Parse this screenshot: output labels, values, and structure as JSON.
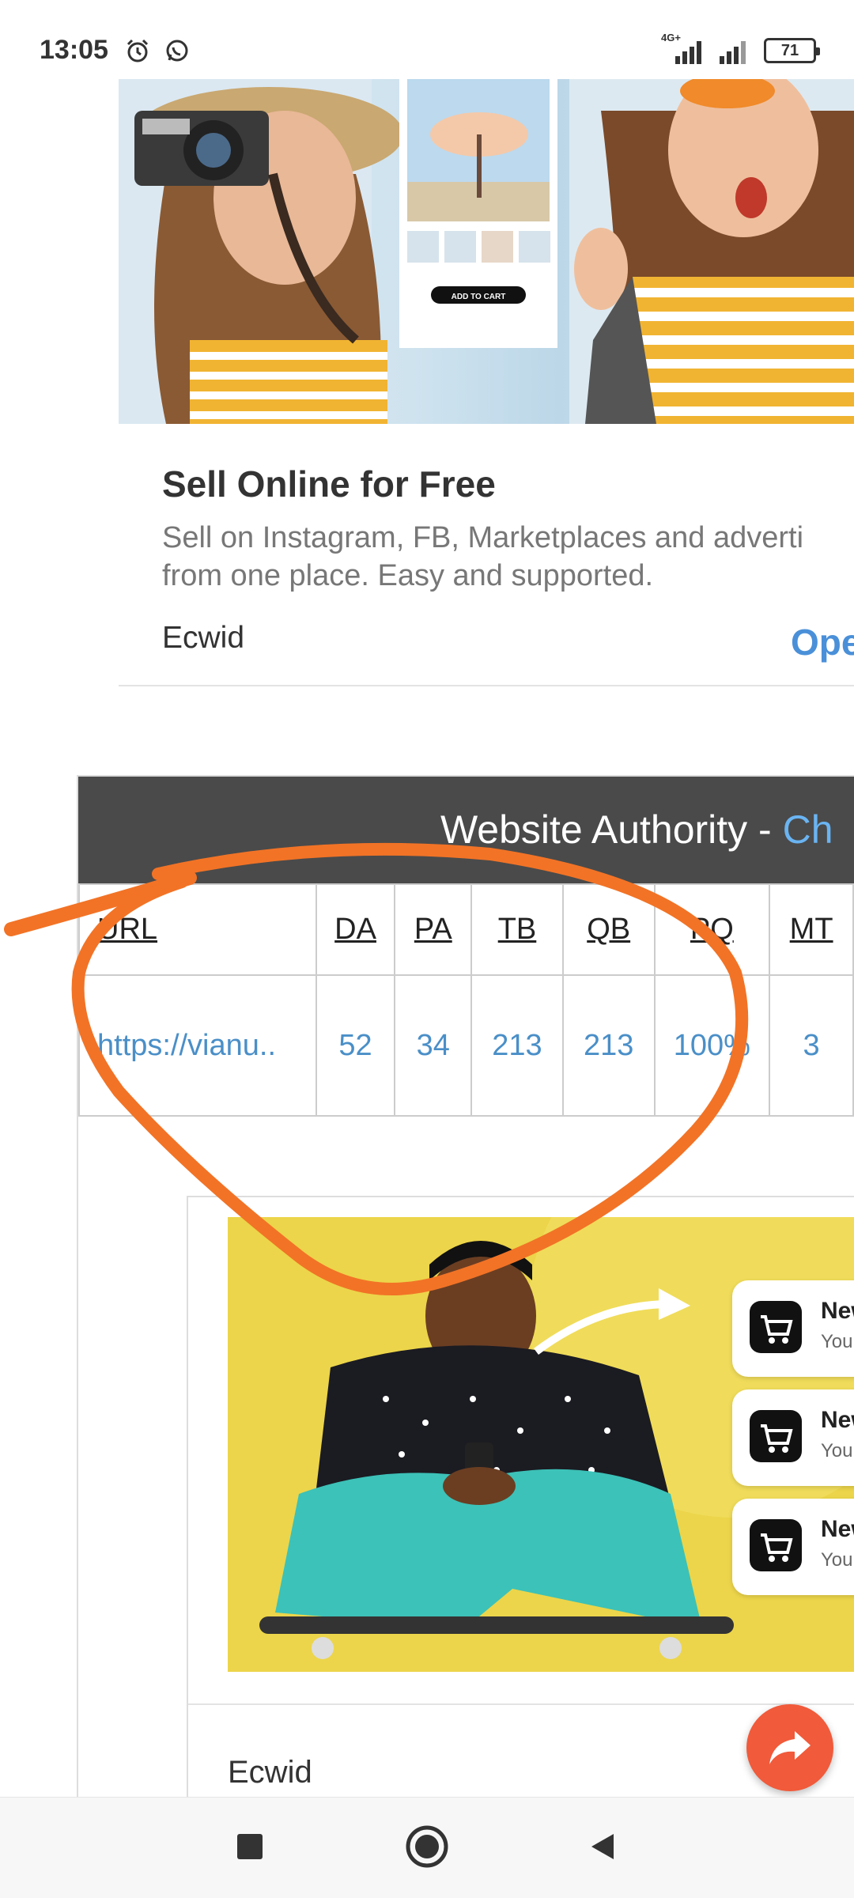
{
  "status_bar": {
    "time": "13:05",
    "network": "4G+",
    "battery": "71",
    "icons": [
      "alarm-icon",
      "whatsapp-icon",
      "signal-icon",
      "signal-icon",
      "battery-icon"
    ]
  },
  "ad_card": {
    "image_button": "ADD TO CART",
    "title": "Sell Online for Free",
    "description_line1": "Sell on Instagram, FB, Marketplaces and adverti",
    "description_line2": "from one place. Easy and supported.",
    "brand": "Ecwid",
    "cta": "Ope"
  },
  "authority": {
    "title": "Website Authority - ",
    "title_accent": "Ch",
    "columns": [
      "URL",
      "DA",
      "PA",
      "TB",
      "QB",
      "PQ",
      "MT"
    ],
    "row": {
      "url": "https://vianu..",
      "da": "52",
      "pa": "34",
      "tb": "213",
      "qb": "213",
      "pq": "100%",
      "mt": "3"
    }
  },
  "inner_ad": {
    "brand": "Ecwid",
    "notifications": [
      {
        "title": "New",
        "subtitle": "You"
      },
      {
        "title": "New",
        "subtitle": "You"
      },
      {
        "title": "New",
        "subtitle": "You"
      }
    ]
  },
  "colors": {
    "link": "#4a8fc8",
    "header_bg": "#4a4a4a",
    "accent": "#6ab4f2",
    "annotation": "#f27326",
    "fab": "#f15a3a"
  },
  "nav": {
    "icons": [
      "recents-square-icon",
      "home-circle-icon",
      "back-triangle-icon"
    ]
  }
}
